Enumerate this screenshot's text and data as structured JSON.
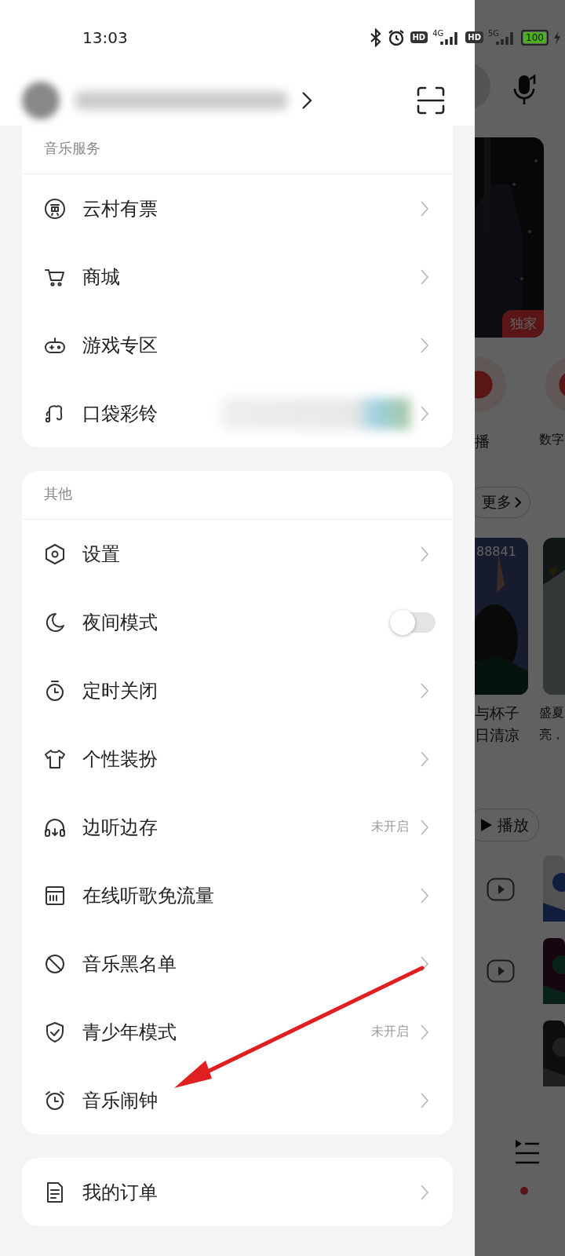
{
  "status_bar": {
    "time": "13:03",
    "hd_badges": [
      "HD",
      "HD"
    ],
    "networks": [
      "4G",
      "5G"
    ],
    "battery": "100"
  },
  "drawer": {
    "sections": [
      {
        "title": "音乐服务",
        "items": [
          {
            "kind": "link",
            "label": "云村有票"
          },
          {
            "kind": "link",
            "label": "商城"
          },
          {
            "kind": "link",
            "label": "游戏专区"
          },
          {
            "kind": "promo",
            "label": "口袋彩铃"
          }
        ]
      },
      {
        "title": "其他",
        "items": [
          {
            "kind": "link",
            "label": "设置"
          },
          {
            "kind": "toggle",
            "label": "夜间模式",
            "on": false
          },
          {
            "kind": "link",
            "label": "定时关闭"
          },
          {
            "kind": "link",
            "label": "个性装扮"
          },
          {
            "kind": "link",
            "label": "边听边存",
            "value": "未开启"
          },
          {
            "kind": "link",
            "label": "在线听歌免流量"
          },
          {
            "kind": "link",
            "label": "音乐黑名单"
          },
          {
            "kind": "link",
            "label": "青少年模式",
            "value": "未开启"
          },
          {
            "kind": "link",
            "label": "音乐闹钟"
          }
        ]
      },
      {
        "items": [
          {
            "kind": "link",
            "label": "我的订单"
          }
        ]
      }
    ]
  },
  "background": {
    "badge": "独家",
    "shortcut_labels": [
      "播",
      "数字"
    ],
    "more_button": "更多",
    "play_count": "88841",
    "captions": [
      [
        "与杯子",
        "日清凉"
      ],
      [
        "盛夏",
        "亮，"
      ]
    ],
    "play_button": "播放"
  }
}
